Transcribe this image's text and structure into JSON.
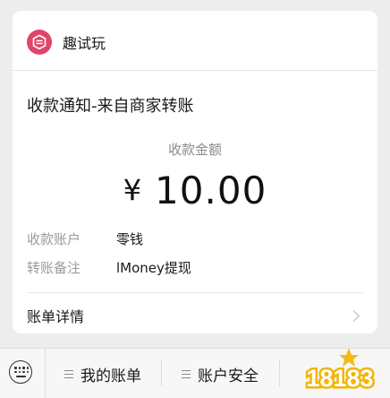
{
  "app": {
    "name": "趣试玩"
  },
  "notice": {
    "title": "收款通知-来自商家转账"
  },
  "amount": {
    "label": "收款金额",
    "currency": "¥",
    "value": "10.00"
  },
  "info": [
    {
      "key": "收款账户",
      "value": "零钱"
    },
    {
      "key": "转账备注",
      "value": "lMoney提现"
    }
  ],
  "details": {
    "label": "账单详情"
  },
  "bottom_menu": [
    {
      "label": "我的账单"
    },
    {
      "label": "账户安全"
    }
  ],
  "watermark": {
    "text": "18183"
  },
  "colors": {
    "logo": "#e0456a",
    "background": "#ededed",
    "watermark": "#f2b400"
  }
}
